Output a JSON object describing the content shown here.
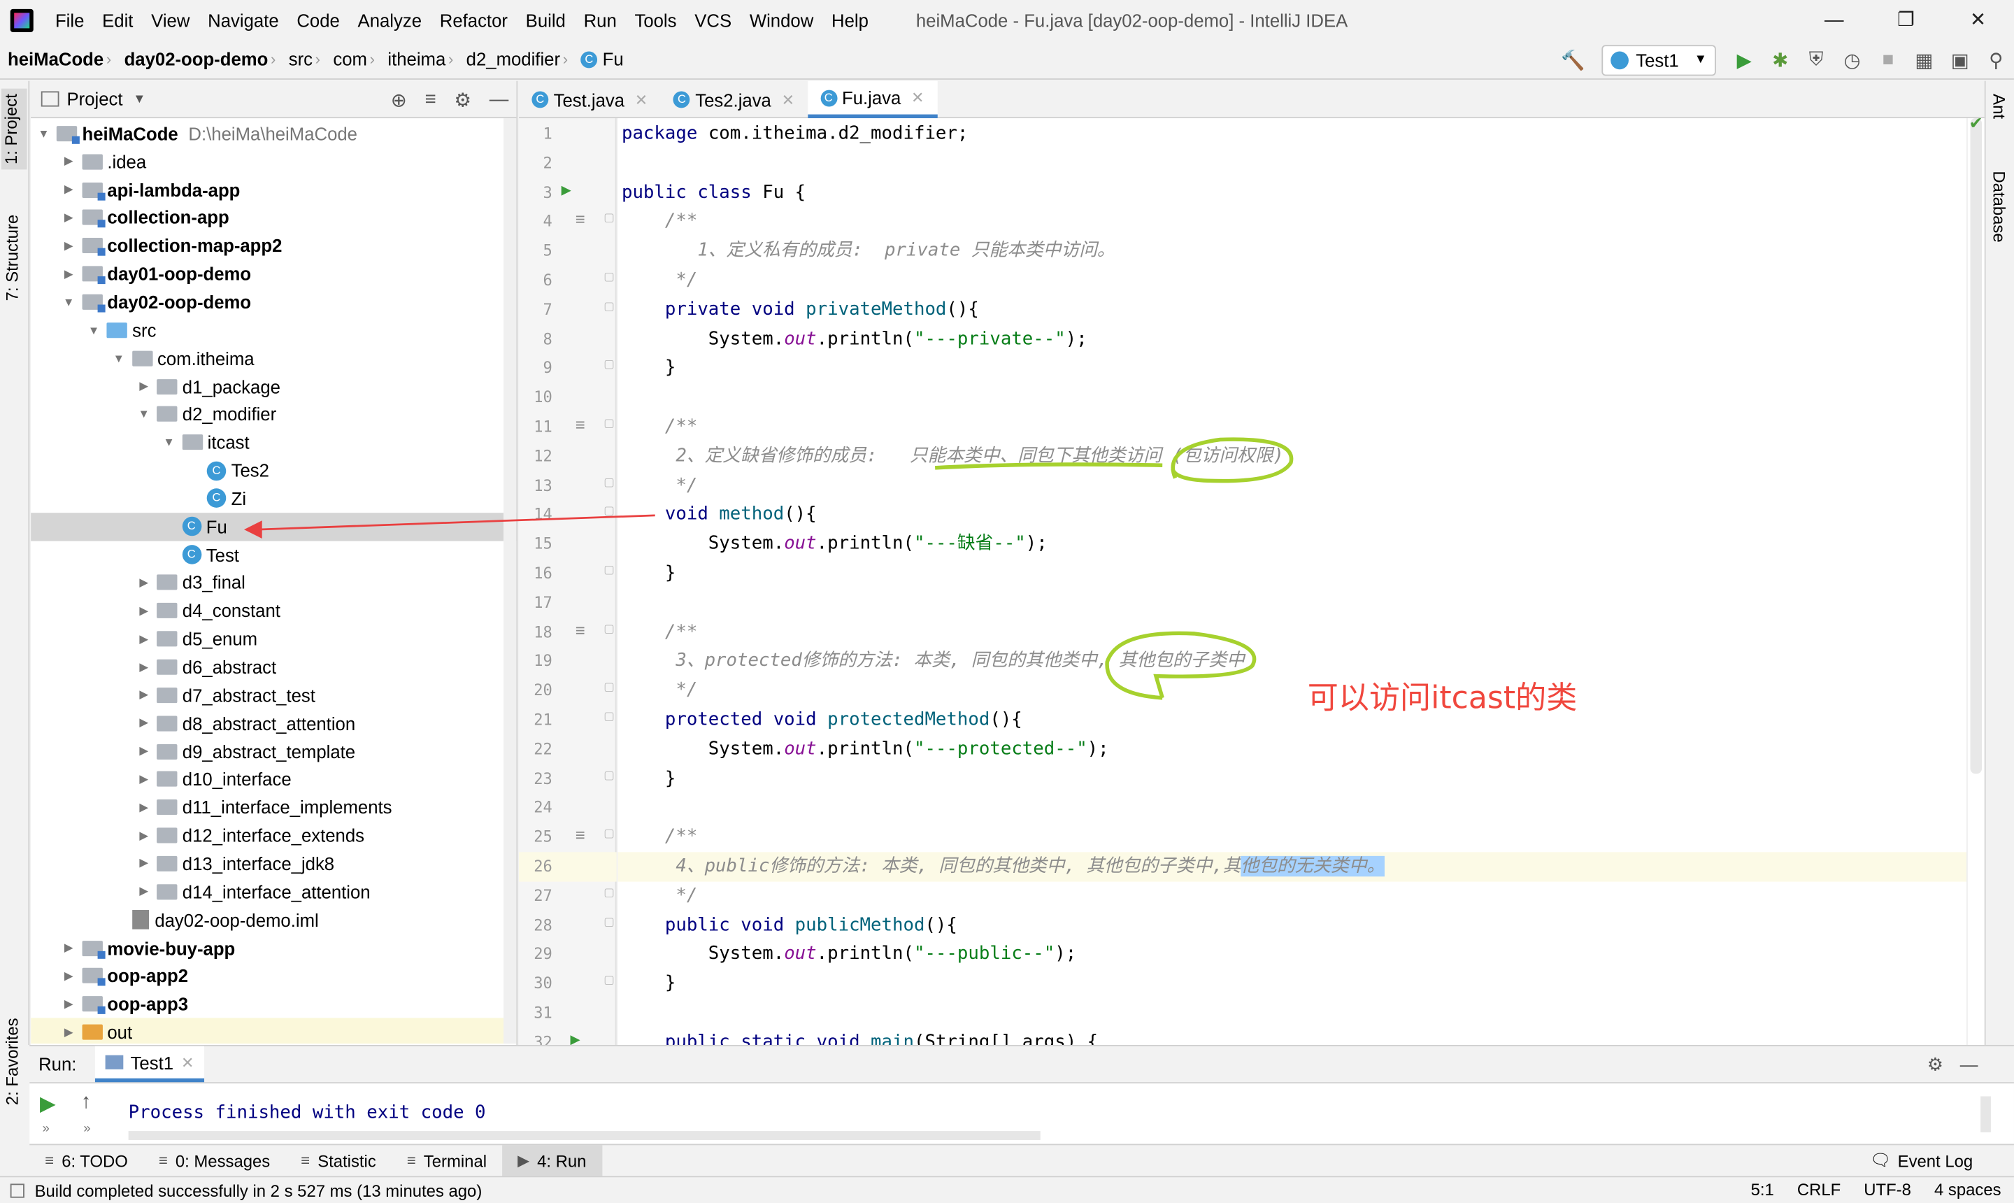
{
  "menu": {
    "items": [
      "File",
      "Edit",
      "View",
      "Navigate",
      "Code",
      "Analyze",
      "Refactor",
      "Build",
      "Run",
      "Tools",
      "VCS",
      "Window",
      "Help"
    ],
    "window_title": "heiMaCode - Fu.java [day02-oop-demo] - IntelliJ IDEA"
  },
  "breadcrumb": [
    "heiMaCode",
    "day02-oop-demo",
    "src",
    "com",
    "itheima",
    "d2_modifier",
    "Fu"
  ],
  "toolbar": {
    "run_config": "Test1"
  },
  "left_stripe": {
    "project": "1: Project",
    "structure": "7: Structure",
    "favorites": "2: Favorites"
  },
  "right_stripe": {
    "ant": "Ant",
    "database": "Database"
  },
  "project": {
    "header": "Project",
    "tree": [
      {
        "label": "heiMaCode",
        "path": "D:\\heiMa\\heiMaCode",
        "indent": 0,
        "arrow": "down",
        "icon": "module",
        "bold": true
      },
      {
        "label": ".idea",
        "indent": 1,
        "arrow": "right",
        "icon": "folder"
      },
      {
        "label": "api-lambda-app",
        "indent": 1,
        "arrow": "right",
        "icon": "module",
        "bold": true
      },
      {
        "label": "collection-app",
        "indent": 1,
        "arrow": "right",
        "icon": "module",
        "bold": true
      },
      {
        "label": "collection-map-app2",
        "indent": 1,
        "arrow": "right",
        "icon": "module",
        "bold": true
      },
      {
        "label": "day01-oop-demo",
        "indent": 1,
        "arrow": "right",
        "icon": "module",
        "bold": true
      },
      {
        "label": "day02-oop-demo",
        "indent": 1,
        "arrow": "down",
        "icon": "module",
        "bold": true
      },
      {
        "label": "src",
        "indent": 2,
        "arrow": "down",
        "icon": "src"
      },
      {
        "label": "com.itheima",
        "indent": 3,
        "arrow": "down",
        "icon": "pkg"
      },
      {
        "label": "d1_package",
        "indent": 4,
        "arrow": "right",
        "icon": "pkg"
      },
      {
        "label": "d2_modifier",
        "indent": 4,
        "arrow": "down",
        "icon": "pkg"
      },
      {
        "label": "itcast",
        "indent": 5,
        "arrow": "down",
        "icon": "pkg"
      },
      {
        "label": "Tes2",
        "indent": 6,
        "arrow": "",
        "icon": "class"
      },
      {
        "label": "Zi",
        "indent": 6,
        "arrow": "",
        "icon": "class"
      },
      {
        "label": "Fu",
        "indent": 5,
        "arrow": "",
        "icon": "class",
        "selected": true
      },
      {
        "label": "Test",
        "indent": 5,
        "arrow": "",
        "icon": "class"
      },
      {
        "label": "d3_final",
        "indent": 4,
        "arrow": "right",
        "icon": "pkg"
      },
      {
        "label": "d4_constant",
        "indent": 4,
        "arrow": "right",
        "icon": "pkg"
      },
      {
        "label": "d5_enum",
        "indent": 4,
        "arrow": "right",
        "icon": "pkg"
      },
      {
        "label": "d6_abstract",
        "indent": 4,
        "arrow": "right",
        "icon": "pkg"
      },
      {
        "label": "d7_abstract_test",
        "indent": 4,
        "arrow": "right",
        "icon": "pkg"
      },
      {
        "label": "d8_abstract_attention",
        "indent": 4,
        "arrow": "right",
        "icon": "pkg"
      },
      {
        "label": "d9_abstract_template",
        "indent": 4,
        "arrow": "right",
        "icon": "pkg"
      },
      {
        "label": "d10_interface",
        "indent": 4,
        "arrow": "right",
        "icon": "pkg"
      },
      {
        "label": "d11_interface_implements",
        "indent": 4,
        "arrow": "right",
        "icon": "pkg"
      },
      {
        "label": "d12_interface_extends",
        "indent": 4,
        "arrow": "right",
        "icon": "pkg"
      },
      {
        "label": "d13_interface_jdk8",
        "indent": 4,
        "arrow": "right",
        "icon": "pkg"
      },
      {
        "label": "d14_interface_attention",
        "indent": 4,
        "arrow": "right",
        "icon": "pkg"
      },
      {
        "label": "day02-oop-demo.iml",
        "indent": 3,
        "arrow": "",
        "icon": "iml"
      },
      {
        "label": "movie-buy-app",
        "indent": 1,
        "arrow": "right",
        "icon": "module",
        "bold": true
      },
      {
        "label": "oop-app2",
        "indent": 1,
        "arrow": "right",
        "icon": "module",
        "bold": true
      },
      {
        "label": "oop-app3",
        "indent": 1,
        "arrow": "right",
        "icon": "module",
        "bold": true
      },
      {
        "label": "out",
        "indent": 1,
        "arrow": "right",
        "icon": "out",
        "highlight": true
      }
    ]
  },
  "editor": {
    "tabs": [
      {
        "label": "Test.java"
      },
      {
        "label": "Tes2.java"
      },
      {
        "label": "Fu.java",
        "active": true
      }
    ],
    "lines": [
      [
        [
          "kw",
          "package "
        ],
        [
          "",
          "com.itheima.d2_modifier;"
        ]
      ],
      [],
      [
        [
          "kw",
          "public class "
        ],
        [
          "",
          "Fu {"
        ]
      ],
      [
        [
          "cm",
          "    /**"
        ]
      ],
      [
        [
          "cm",
          "       1、定义私有的成员:  private 只能本类中访问。"
        ]
      ],
      [
        [
          "cm",
          "     */"
        ]
      ],
      [
        [
          "kw",
          "    private void "
        ],
        [
          "fn",
          "privateMethod"
        ],
        [
          "",
          "(){"
        ]
      ],
      [
        [
          "",
          "        System."
        ],
        [
          "it",
          "out"
        ],
        [
          "",
          ".println("
        ],
        [
          "st",
          "\"---private--\""
        ],
        [
          "",
          ");"
        ]
      ],
      [
        [
          "",
          "    }"
        ]
      ],
      [],
      [
        [
          "cm",
          "    /**"
        ]
      ],
      [
        [
          "cm",
          "     2、定义缺省修饰的成员:   只能本类中、同包下其他类访问 (包访问权限)"
        ]
      ],
      [
        [
          "cm",
          "     */"
        ]
      ],
      [
        [
          "kw",
          "    void "
        ],
        [
          "fn",
          "method"
        ],
        [
          "",
          "(){"
        ]
      ],
      [
        [
          "",
          "        System."
        ],
        [
          "it",
          "out"
        ],
        [
          "",
          ".println("
        ],
        [
          "st",
          "\"---缺省--\""
        ],
        [
          "",
          ");"
        ]
      ],
      [
        [
          "",
          "    }"
        ]
      ],
      [],
      [
        [
          "cm",
          "    /**"
        ]
      ],
      [
        [
          "cm",
          "     3、protected修饰的方法: 本类, 同包的其他类中, 其他包的子类中"
        ]
      ],
      [
        [
          "cm",
          "     */"
        ]
      ],
      [
        [
          "kw",
          "    protected void "
        ],
        [
          "fn",
          "protectedMethod"
        ],
        [
          "",
          "(){"
        ]
      ],
      [
        [
          "",
          "        System."
        ],
        [
          "it",
          "out"
        ],
        [
          "",
          ".println("
        ],
        [
          "st",
          "\"---protected--\""
        ],
        [
          "",
          ");"
        ]
      ],
      [
        [
          "",
          "    }"
        ]
      ],
      [],
      [
        [
          "cm",
          "    /**"
        ]
      ],
      [
        [
          "cm",
          "     4、public修饰的方法: 本类, 同包的其他类中, 其他包的子类中,其"
        ],
        [
          "cm sel",
          "他包的无关类中。"
        ]
      ],
      [
        [
          "cm",
          "     */"
        ]
      ],
      [
        [
          "kw",
          "    public void "
        ],
        [
          "fn",
          "publicMethod"
        ],
        [
          "",
          "(){"
        ]
      ],
      [
        [
          "",
          "        System."
        ],
        [
          "it",
          "out"
        ],
        [
          "",
          ".println("
        ],
        [
          "st",
          "\"---public--\""
        ],
        [
          "",
          ");"
        ]
      ],
      [
        [
          "",
          "    }"
        ]
      ],
      [],
      [
        [
          "kw",
          "    public static void "
        ],
        [
          "fn",
          "main"
        ],
        [
          "",
          "(String[] args) {"
        ]
      ]
    ],
    "line_numbers": [
      "1",
      "2",
      "3",
      "4",
      "5",
      "6",
      "7",
      "8",
      "9",
      "10",
      "11",
      "12",
      "13",
      "14",
      "15",
      "16",
      "17",
      "18",
      "19",
      "20",
      "21",
      "22",
      "23",
      "24",
      "25",
      "26",
      "27",
      "28",
      "29",
      "30",
      "31",
      "32"
    ],
    "current_line": 26
  },
  "annotation": {
    "text": "可以访问itcast的类",
    "color": "#f0473d"
  },
  "run": {
    "label": "Run:",
    "tab": "Test1",
    "output": "Process finished with exit code 0"
  },
  "bottom_tabs": [
    {
      "label": "6: TODO",
      "icon": "list-icon"
    },
    {
      "label": "0: Messages",
      "icon": "messages-icon"
    },
    {
      "label": "Statistic",
      "icon": "statistic-icon"
    },
    {
      "label": "Terminal",
      "icon": "terminal-icon"
    },
    {
      "label": "4: Run",
      "icon": "run-icon",
      "active": true
    }
  ],
  "event_log": "Event Log",
  "status": {
    "message": "Build completed successfully in 2 s 527 ms (13 minutes ago)",
    "position": "5:1",
    "line_sep": "CRLF",
    "encoding": "UTF-8",
    "indent": "4 spaces"
  }
}
